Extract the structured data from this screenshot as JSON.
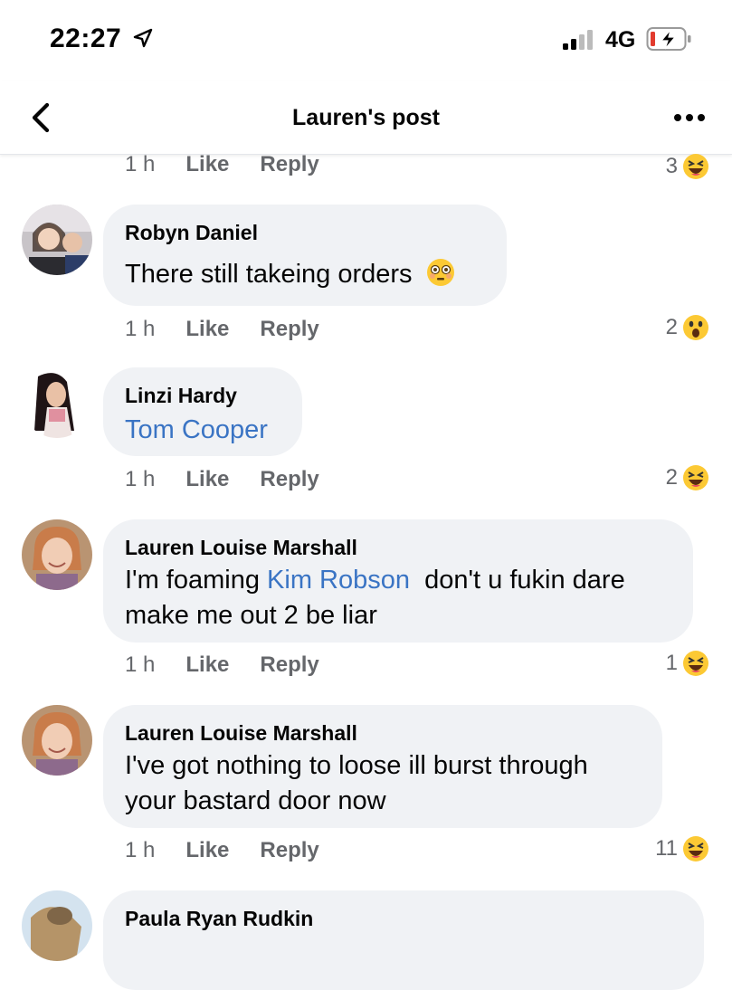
{
  "status": {
    "time": "22:27",
    "network": "4G"
  },
  "header": {
    "title": "Lauren's post"
  },
  "comments": [
    {
      "author": "",
      "time": "1 h",
      "like": "Like",
      "reply": "Reply",
      "reactions": "3",
      "reaction_type": "laugh-emoji-icon"
    },
    {
      "author": "Robyn Daniel",
      "text": "There still takeing orders",
      "emoji": "flushed-emoji-icon",
      "time": "1 h",
      "like": "Like",
      "reply": "Reply",
      "reactions": "2",
      "reaction_type": "wow-emoji-icon"
    },
    {
      "author": "Linzi Hardy",
      "mention": "Tom Cooper",
      "time": "1 h",
      "like": "Like",
      "reply": "Reply",
      "reactions": "2",
      "reaction_type": "laugh-emoji-icon"
    },
    {
      "author": "Lauren Louise Marshall",
      "text_before": "I'm foaming ",
      "mention": "Kim Robson",
      "text_after": "  don't u fukin dare",
      "text_line2": "make me out 2 be liar",
      "time": "1 h",
      "like": "Like",
      "reply": "Reply",
      "reactions": "1",
      "reaction_type": "laugh-emoji-icon"
    },
    {
      "author": "Lauren Louise Marshall",
      "text_line1": "I've got nothing to loose ill burst through",
      "text_line2": "your bastard door now",
      "time": "1 h",
      "like": "Like",
      "reply": "Reply",
      "reactions": "11",
      "reaction_type": "laugh-emoji-icon"
    },
    {
      "author": "Paula Ryan Rudkin"
    }
  ]
}
